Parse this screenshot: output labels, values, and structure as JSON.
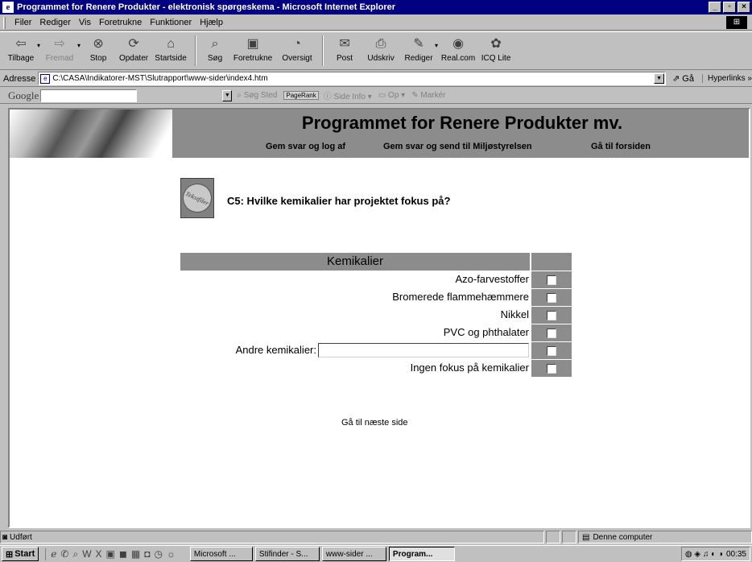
{
  "window": {
    "title": "Programmet for Renere Produkter - elektronisk spørgeskema - Microsoft Internet Explorer",
    "min": "_",
    "max": "▫",
    "close": "×"
  },
  "menu": [
    "Filer",
    "Rediger",
    "Vis",
    "Foretrukne",
    "Funktioner",
    "Hjælp"
  ],
  "toolbar": {
    "back": "Tilbage",
    "forward": "Fremad",
    "stop": "Stop",
    "refresh": "Opdater",
    "home": "Startside",
    "search": "Søg",
    "favorites": "Foretrukne",
    "history": "Oversigt",
    "mail": "Post",
    "print": "Udskriv",
    "edit": "Rediger",
    "realcom": "Real.com",
    "icq": "ICQ Lite"
  },
  "address": {
    "label": "Adresse",
    "value": "C:\\CASA\\Indikatorer-MST\\Slutrapport\\www-sider\\index4.htm",
    "go": "Gå",
    "links": "Hyperlinks »"
  },
  "google": {
    "logo": "Google",
    "search_site": "Søg Sted",
    "pagerank": "PageRank",
    "page_info": "Side Info",
    "up": "Op",
    "highlight": "Markér"
  },
  "page": {
    "site_title": "Programmet for Renere Produkter mv.",
    "nav": {
      "save_logout": "Gem svar og log af",
      "save_send": "Gem svar og send til Miljøstyrelsen",
      "home": "Gå til forsiden"
    },
    "icon_text": "Tekstfiler",
    "question": "C5: Hvilke kemikalier har projektet fokus på?",
    "table_header": "Kemikalier",
    "options": [
      "Azo-farvestoffer",
      "Bromerede flammehæmmere",
      "Nikkel",
      "PVC og phthalater"
    ],
    "other_label": "Andre kemikalier:",
    "other_value": "",
    "none_label": "Ingen fokus på kemikalier",
    "next": "Gå til næste side"
  },
  "status": {
    "text": "Udført",
    "zone": "Denne computer"
  },
  "taskbar": {
    "start": "Start",
    "tasks": [
      "Microsoft ...",
      "Stifinder - S...",
      "www-sider ...",
      "Program..."
    ],
    "clock": "00:35"
  }
}
